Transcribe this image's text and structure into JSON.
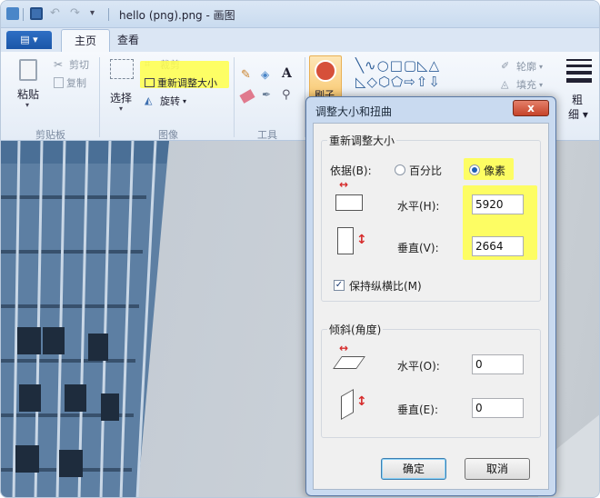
{
  "window": {
    "title": "hello (png).png - 画图",
    "quick_access": [
      "save-icon",
      "undo-icon",
      "redo-icon",
      "customize-icon"
    ]
  },
  "tabs": {
    "file_menu_icon": "menu-icon",
    "home": "主页",
    "view": "查看"
  },
  "ribbon": {
    "clipboard": {
      "paste": "粘贴",
      "cut": "剪切",
      "copy": "复制",
      "label": "剪贴板"
    },
    "image": {
      "select": "选择",
      "crop": "裁剪",
      "resize": "重新调整大小",
      "rotate": "旋转",
      "label": "图像"
    },
    "tools": {
      "text_tool": "A",
      "label": "工具"
    },
    "brushes": {
      "label": "刷子"
    },
    "shapes": {
      "outline": "轮廓",
      "fill": "填充"
    },
    "size": {
      "label_line1": "粗",
      "label_line2": "细"
    }
  },
  "dialog": {
    "title": "调整大小和扭曲",
    "close": "x",
    "resize": {
      "group_label": "重新调整大小",
      "by_label": "依据(B):",
      "option_percent": "百分比",
      "option_pixels": "像素",
      "selected": "pixels",
      "horizontal_label": "水平(H):",
      "horizontal_value": "5920",
      "vertical_label": "垂直(V):",
      "vertical_value": "2664",
      "keep_ratio_label": "保持纵横比(M)",
      "keep_ratio_checked": true
    },
    "skew": {
      "group_label": "倾斜(角度)",
      "horizontal_label": "水平(O):",
      "horizontal_value": "0",
      "vertical_label": "垂直(E):",
      "vertical_value": "0"
    },
    "ok": "确定",
    "cancel": "取消"
  },
  "colors": {
    "highlight": "#ffff4a",
    "accent": "#1f5fb5",
    "close_red": "#c6432a"
  }
}
